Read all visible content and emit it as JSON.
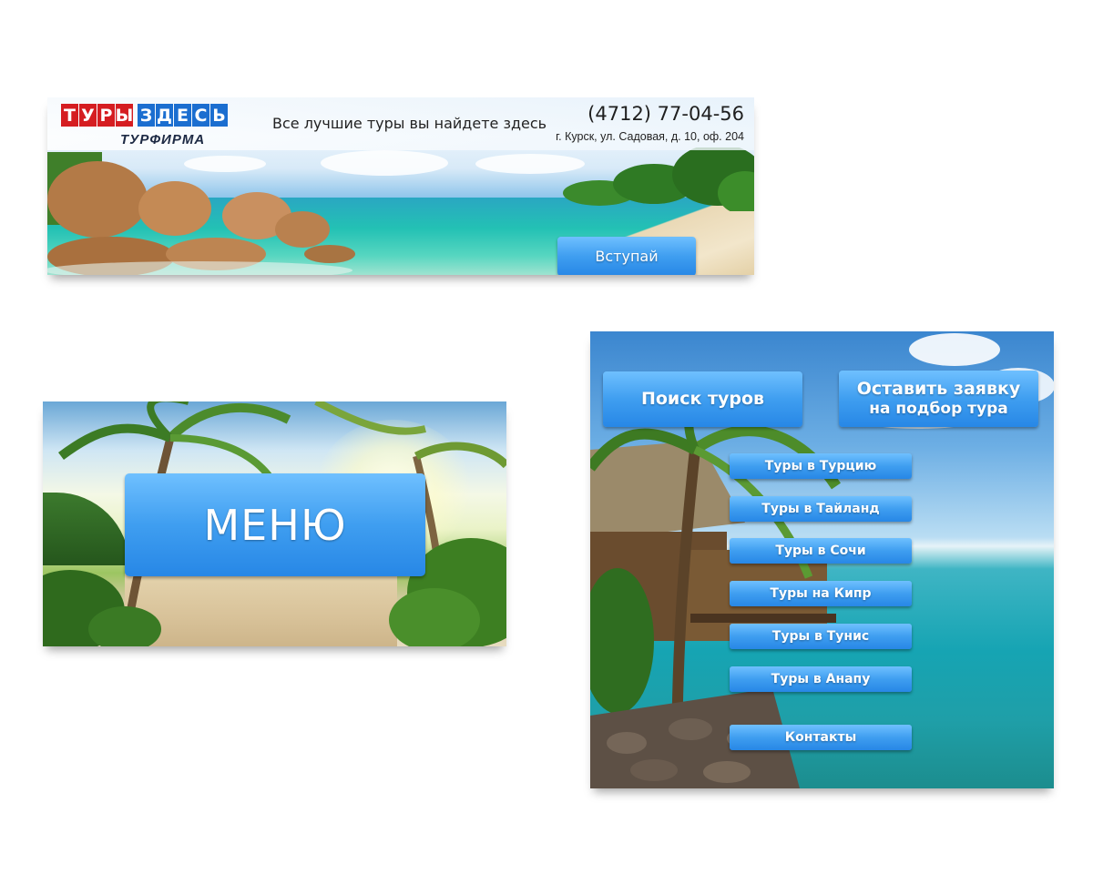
{
  "banner": {
    "logo_letters": [
      "Т",
      "У",
      "Р",
      "Ы",
      "З",
      "Д",
      "Е",
      "С",
      "Ь"
    ],
    "logo_word1": "ТУРЫ",
    "logo_word2": "ЗДЕСЬ",
    "logo_subtitle": "ТУРФИРМА",
    "slogan": "Все лучшие туры вы найдете здесь",
    "phone": "(4712) 77-04-56",
    "address": "г. Курск, ул. Садовая, д. 10, оф. 204",
    "join_button": "Вступай"
  },
  "menu_card": {
    "menu_button": "МЕНЮ"
  },
  "nav_card": {
    "search_tours": "Поиск туров",
    "request_tour_line1": "Оставить заявку",
    "request_tour_line2": "на подбор тура",
    "items": [
      {
        "label": "Туры в Турцию"
      },
      {
        "label": "Туры в Тайланд"
      },
      {
        "label": "Туры в Сочи"
      },
      {
        "label": "Туры на Кипр"
      },
      {
        "label": "Туры в Тунис"
      },
      {
        "label": "Туры в Анапу"
      }
    ],
    "contacts": "Контакты"
  },
  "colors": {
    "logo_red": "#d51d21",
    "logo_blue": "#1b6ed0",
    "button_blue": "#3f9ef0"
  }
}
